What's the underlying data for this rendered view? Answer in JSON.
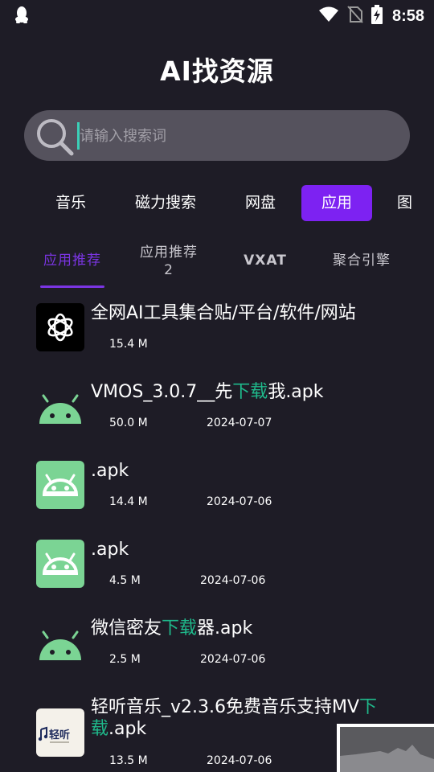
{
  "status_bar": {
    "time": "8:58"
  },
  "app_title": "AI找资源",
  "search": {
    "placeholder": "请输入搜索词",
    "value": ""
  },
  "main_tabs": [
    {
      "label": "音乐",
      "active": false
    },
    {
      "label": "磁力搜索",
      "active": false
    },
    {
      "label": "网盘",
      "active": false
    },
    {
      "label": "应用",
      "active": true
    },
    {
      "label": "图",
      "active": false
    }
  ],
  "sub_tabs": [
    {
      "label": "应用推荐",
      "active": true
    },
    {
      "label": "应用推荐\n2",
      "active": false
    },
    {
      "label": "VXAT",
      "active": false
    },
    {
      "label": "聚合引擎",
      "active": false
    }
  ],
  "items": [
    {
      "icon": "openai-icon",
      "name_parts": [
        "全网AI工具集合贴/平台/软件/网站"
      ],
      "size": "15.4 M",
      "date": ""
    },
    {
      "icon": "android-icon",
      "name_parts": [
        "VMOS_3.0.7__先",
        "下载",
        "我.apk"
      ],
      "size": "50.0 M",
      "date": "2024-07-07"
    },
    {
      "icon": "android-box-icon",
      "name_parts": [
        ".apk"
      ],
      "size": "14.4 M",
      "date": "2024-07-06"
    },
    {
      "icon": "android-box-icon",
      "name_parts": [
        ".apk"
      ],
      "size": "4.5 M",
      "date": "2024-07-06"
    },
    {
      "icon": "android-icon",
      "name_parts": [
        "微信密友",
        "下载",
        "器.apk"
      ],
      "size": "2.5 M",
      "date": "2024-07-06"
    },
    {
      "icon": "qingting-icon",
      "name_parts": [
        "轻听音乐_v2.3.6免费音乐支持MV",
        "下载",
        ".apk"
      ],
      "size": "13.5 M",
      "date": "2024-07-06"
    }
  ],
  "colors": {
    "accent": "#7d22f2",
    "highlight": "#1fb98b",
    "background": "#1e1c26",
    "android_green": "#7bd494"
  }
}
